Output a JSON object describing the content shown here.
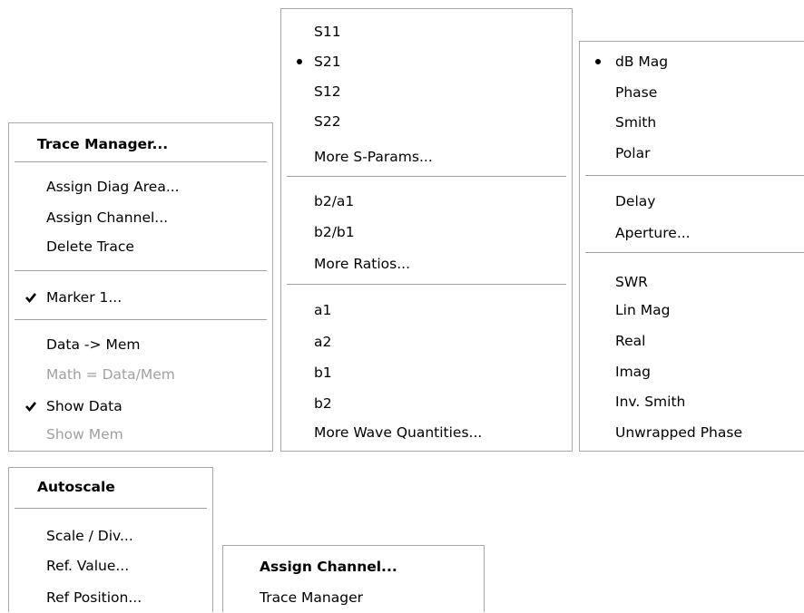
{
  "trace_menu": {
    "title": "Trace Manager...",
    "assign_diag_area": "Assign Diag Area...",
    "assign_channel": "Assign Channel...",
    "delete_trace": "Delete Trace",
    "marker_1": "Marker 1...",
    "marker_1_checked": true,
    "data_to_mem": "Data -> Mem",
    "math": "Math = Data/Mem",
    "math_enabled": false,
    "show_data": "Show Data",
    "show_data_checked": true,
    "show_mem": "Show Mem",
    "show_mem_enabled": false
  },
  "meas_menu": {
    "s11": "S11",
    "s21": "S21",
    "selected": "S21",
    "s12": "S12",
    "s22": "S22",
    "more_s_params": "More S-Params...",
    "b2_a1": "b2/a1",
    "b2_b1": "b2/b1",
    "more_ratios": "More Ratios...",
    "a1": "a1",
    "a2": "a2",
    "b1": "b1",
    "b2": "b2",
    "more_wave": "More Wave Quantities..."
  },
  "format_menu": {
    "db_mag": "dB Mag",
    "selected": "dB Mag",
    "phase": "Phase",
    "smith": "Smith",
    "polar": "Polar",
    "delay": "Delay",
    "aperture": "Aperture...",
    "swr": "SWR",
    "lin_mag": "Lin Mag",
    "real": "Real",
    "imag": "Imag",
    "inv_smith": "Inv. Smith",
    "unwrapped_phase": "Unwrapped Phase"
  },
  "scale_menu": {
    "title": "Autoscale",
    "scale_div": "Scale / Div...",
    "ref_value": "Ref. Value...",
    "ref_position": "Ref Position..."
  },
  "channel_menu": {
    "title": "Assign Channel...",
    "trace_manager": "Trace Manager"
  }
}
